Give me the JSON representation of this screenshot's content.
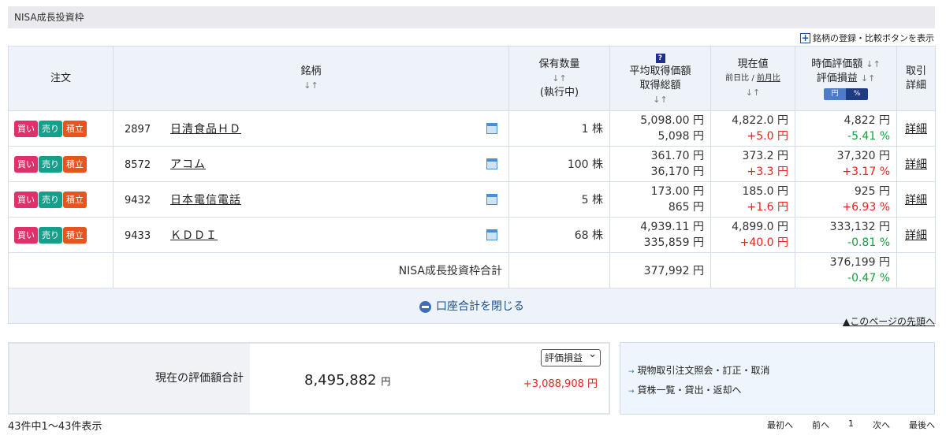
{
  "section": {
    "title": "NISA成長投資枠",
    "toggle_label": "銘柄の登録・比較ボタンを表示"
  },
  "table": {
    "headers": {
      "order": "注文",
      "stock": "銘柄",
      "qty_line1": "保有数量",
      "qty_line3": "(執行中)",
      "avg_line1": "平均取得価額",
      "avg_line2": "取得総額",
      "price_line1": "現在値",
      "price_sub1": "前日比",
      "price_sub_sep": "/",
      "price_sub2": "前月比",
      "val_line1": "時価評価額",
      "val_line2": "評価損益",
      "unit_yen": "円",
      "unit_pct": "%",
      "detail_line1": "取引",
      "detail_line2": "詳細",
      "sort_mark": "↓↑",
      "help_mark": "?"
    },
    "buttons": {
      "buy": "買い",
      "sell": "売り",
      "save": "積立"
    },
    "rows": [
      {
        "code": "2897",
        "name": "日清食品ＨＤ",
        "qty": "1 株",
        "avg_price": "5,098.00 円",
        "total_cost": "5,098 円",
        "price": "4,822.0 円",
        "change": "+5.0 円",
        "value": "4,822 円",
        "gain": "-5.41 %",
        "gain_dir": "down",
        "detail": "詳細"
      },
      {
        "code": "8572",
        "name": "アコム",
        "qty": "100 株",
        "avg_price": "361.70 円",
        "total_cost": "36,170 円",
        "price": "373.2 円",
        "change": "+3.3 円",
        "value": "37,320 円",
        "gain": "+3.17 %",
        "gain_dir": "up",
        "detail": "詳細"
      },
      {
        "code": "9432",
        "name": "日本電信電話",
        "qty": "5 株",
        "avg_price": "173.00 円",
        "total_cost": "865 円",
        "price": "185.0 円",
        "change": "+1.6 円",
        "value": "925 円",
        "gain": "+6.93 %",
        "gain_dir": "up",
        "detail": "詳細"
      },
      {
        "code": "9433",
        "name": "ＫＤＤＩ",
        "qty": "68 株",
        "avg_price": "4,939.11 円",
        "total_cost": "335,859 円",
        "price": "4,899.0 円",
        "change": "+40.0 円",
        "value": "333,132 円",
        "gain": "-0.81 %",
        "gain_dir": "down",
        "detail": "詳細"
      }
    ],
    "total": {
      "label": "NISA成長投資枠合計",
      "cost": "377,992 円",
      "value": "376,199 円",
      "gain": "-0.47 %"
    },
    "close_label": "口座合計を閉じる"
  },
  "page_top": "▲このページの先頭へ",
  "summary": {
    "label": "現在の評価額合計",
    "value": "8,495,882",
    "value_unit": "円",
    "select_value": "評価損益",
    "gain": "+3,088,908 円"
  },
  "links": {
    "link1": "現物取引注文照会・訂正・取消",
    "link2": "貸株一覧・貸出・返却へ"
  },
  "footer": {
    "count": "43件中1～43件表示",
    "first": "最初へ",
    "prev": "前へ",
    "page": "1",
    "next": "次へ",
    "last": "最後へ"
  },
  "colors": {
    "positive": "#e8231f",
    "negative": "#13a33b",
    "accent": "#1b4f8c"
  }
}
